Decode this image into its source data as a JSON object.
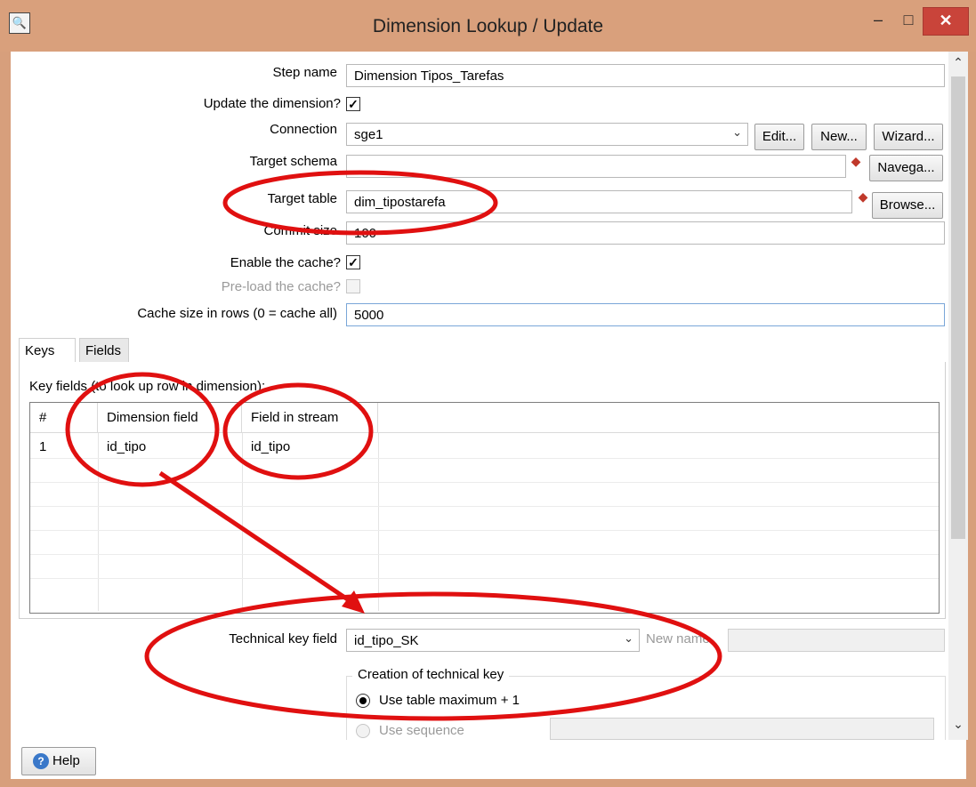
{
  "window": {
    "title": "Dimension Lookup / Update",
    "minimize_glyph": "–",
    "maximize_glyph": "□",
    "close_glyph": "✕",
    "app_icon_glyph": "🔍"
  },
  "form": {
    "step_name_label": "Step name",
    "step_name_value": "Dimension Tipos_Tarefas",
    "update_dimension_label": "Update the dimension?",
    "update_dimension_checked": true,
    "connection_label": "Connection",
    "connection_value": "sge1",
    "edit_label": "Edit...",
    "new_label": "New...",
    "wizard_label": "Wizard...",
    "target_schema_label": "Target schema",
    "target_schema_value": "",
    "navigate_label": "Navega...",
    "target_table_label": "Target table",
    "target_table_value": "dim_tipostarefa",
    "browse_label": "Browse...",
    "commit_size_label": "Commit size",
    "commit_size_value": "100",
    "enable_cache_label": "Enable the cache?",
    "enable_cache_checked": true,
    "preload_cache_label": "Pre-load the cache?",
    "preload_cache_checked": false,
    "cache_size_label": "Cache size in rows (0 = cache all)",
    "cache_size_value": "5000"
  },
  "tabs": [
    {
      "label": "Keys",
      "active": true
    },
    {
      "label": "Fields",
      "active": false
    }
  ],
  "keys_panel": {
    "caption": "Key fields (to look up row in dimension):",
    "columns": [
      "#",
      "Dimension field",
      "Field in stream"
    ],
    "rows": [
      {
        "num": "1",
        "dimension_field": "id_tipo",
        "field_in_stream": "id_tipo"
      }
    ]
  },
  "technical_key": {
    "label": "Technical key field",
    "value": "id_tipo_SK",
    "new_name_label": "New name",
    "new_name_value": ""
  },
  "creation": {
    "title": "Creation of technical key",
    "option_table_max": "Use table maximum + 1",
    "option_sequence": "Use sequence",
    "selected": "table_max"
  },
  "footer": {
    "help_label": "Help"
  },
  "colors": {
    "titlebar": "#d9a07c",
    "annotation_red": "#e01010",
    "close_button": "#c9443a"
  }
}
